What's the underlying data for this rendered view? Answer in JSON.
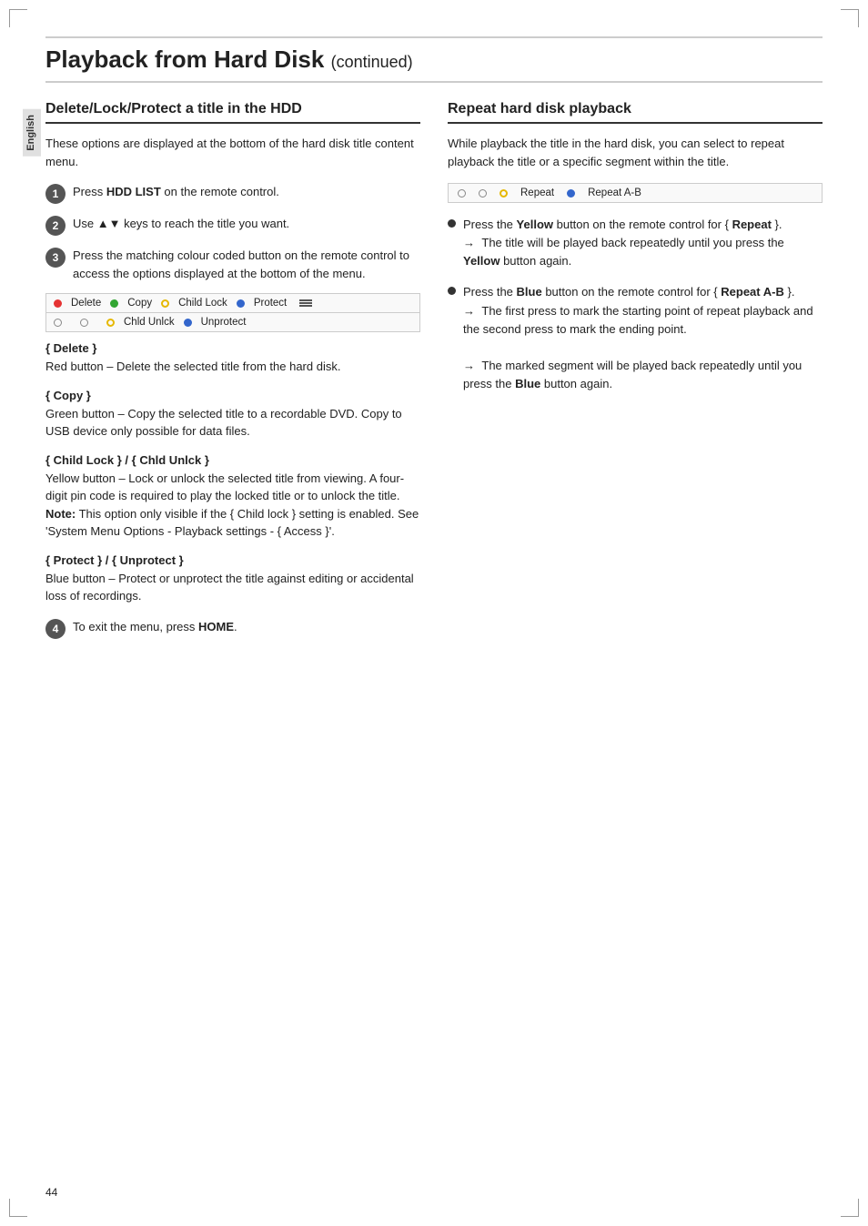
{
  "page": {
    "title": "Playback from Hard Disk",
    "continued": "(continued)",
    "page_number": "44",
    "sidebar_label": "English"
  },
  "left_column": {
    "heading": "Delete/Lock/Protect a title in the HDD",
    "intro": "These options are displayed at the bottom of the hard disk title content menu.",
    "steps": [
      {
        "number": "1",
        "text_parts": [
          "Press ",
          "HDD LIST",
          " on the remote control."
        ]
      },
      {
        "number": "2",
        "text_parts": [
          "Use ▲▼ keys to reach the title you want."
        ]
      },
      {
        "number": "3",
        "text_parts": [
          "Press the matching colour coded button on the remote control to access the options displayed at the bottom of the menu."
        ]
      }
    ],
    "button_bar_top": [
      {
        "color": "red",
        "label": "Delete"
      },
      {
        "color": "green",
        "label": "Copy"
      },
      {
        "color": "yellow_circle",
        "label": "Child Lock"
      },
      {
        "color": "blue",
        "label": "Protect"
      }
    ],
    "button_bar_bottom": [
      {
        "color": "gray",
        "label": ""
      },
      {
        "color": "gray",
        "label": ""
      },
      {
        "color": "yellow_circle",
        "label": "Chld Unlck"
      },
      {
        "color": "blue",
        "label": "Unprotect"
      }
    ],
    "definitions": [
      {
        "title": "{ Delete }",
        "text": "Red button – Delete the selected title from the hard disk."
      },
      {
        "title": "{ Copy }",
        "text": "Green button – Copy the selected title to a recordable DVD.  Copy to USB device only possible for data files."
      },
      {
        "title": "{ Child Lock } / { Chld Unlck }",
        "text": "Yellow button – Lock or unlock the selected title from viewing.  A four-digit pin code is required to play the locked title or to unlock the title.",
        "note": "Note:  This option only visible if the { Child lock } setting is enabled.  See 'System Menu Options - Playback settings - { Access }'."
      },
      {
        "title": "{ Protect } / { Unprotect }",
        "text": "Blue button – Protect or unprotect the title against editing or accidental loss of recordings."
      }
    ],
    "step4": {
      "number": "4",
      "text": "To exit the menu, press ",
      "bold": "HOME",
      "suffix": "."
    }
  },
  "right_column": {
    "heading": "Repeat hard disk playback",
    "intro": "While playback the title in the hard disk, you can select to repeat playback the title or a specific segment within the title.",
    "repeat_bar": [
      {
        "type": "empty",
        "label": ""
      },
      {
        "type": "empty",
        "label": ""
      },
      {
        "type": "circle_yellow",
        "label": "Repeat"
      },
      {
        "type": "dot_blue",
        "label": "Repeat A-B"
      }
    ],
    "bullets": [
      {
        "text_parts": [
          "Press the ",
          "Yellow",
          " button on the remote control for { ",
          "Repeat",
          " }."
        ],
        "arrow_text": "The title will be played back repeatedly until you press the ",
        "arrow_bold": "Yellow",
        "arrow_suffix": " button again."
      },
      {
        "text_parts": [
          "Press the ",
          "Blue",
          " button on the remote control for { ",
          "Repeat A-B",
          " }."
        ],
        "arrows": [
          {
            "text": "The first press to mark the starting point of repeat playback and the second press to mark the ending point."
          },
          {
            "text": "The marked segment will be played back repeatedly until you press the ",
            "bold": "Blue",
            "suffix": " button again."
          }
        ]
      }
    ]
  }
}
